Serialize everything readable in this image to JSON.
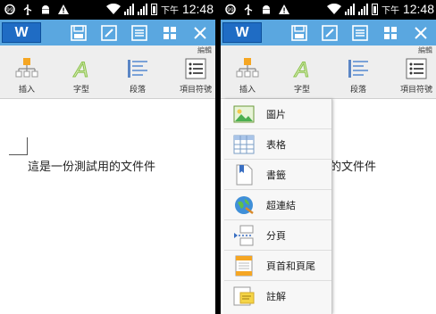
{
  "status_bar": {
    "ampm": "下午",
    "time": "12:48"
  },
  "toolbar": {
    "logo": "W"
  },
  "ribbon": {
    "category": "編輯",
    "items": [
      {
        "label": "插入"
      },
      {
        "label": "字型"
      },
      {
        "label": "段落"
      },
      {
        "label": "項目符號"
      }
    ]
  },
  "document": {
    "text": "這是一份測試用的文件件"
  },
  "insert_menu": {
    "items": [
      {
        "label": "圖片",
        "icon": "picture-icon"
      },
      {
        "label": "表格",
        "icon": "table-icon"
      },
      {
        "label": "書籤",
        "icon": "bookmark-icon"
      },
      {
        "label": "超連結",
        "icon": "hyperlink-icon"
      },
      {
        "label": "分頁",
        "icon": "page-break-icon"
      },
      {
        "label": "頁首和頁尾",
        "icon": "header-footer-icon"
      },
      {
        "label": "註解",
        "icon": "comment-icon"
      }
    ]
  },
  "colors": {
    "toolbar": "#5aa7e0",
    "logo": "#1f6cc4",
    "ribbon": "#eeeeee",
    "accent_orange": "#f5a623"
  }
}
